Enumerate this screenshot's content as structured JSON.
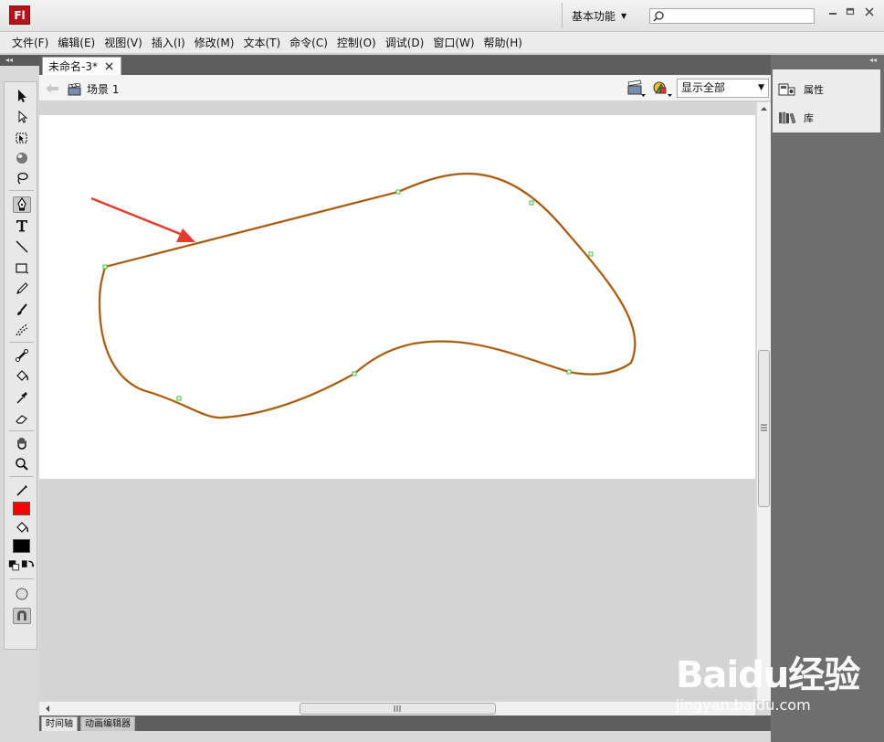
{
  "app": {
    "logo_text": "Fl"
  },
  "titlebar": {
    "workspace_label": "基本功能",
    "search_value": ""
  },
  "menu": {
    "items": [
      "文件(F)",
      "编辑(E)",
      "视图(V)",
      "插入(I)",
      "修改(M)",
      "文本(T)",
      "命令(C)",
      "控制(O)",
      "调试(D)",
      "窗口(W)",
      "帮助(H)"
    ]
  },
  "document": {
    "tab_label": "未命名-3*",
    "scene_label": "场景 1",
    "zoom_value": "显示全部"
  },
  "right_panel": {
    "items": [
      {
        "label": "属性",
        "icon": "properties-icon"
      },
      {
        "label": "库",
        "icon": "library-icon"
      }
    ]
  },
  "bottom_tabs": [
    "时间轴",
    "动画编辑器"
  ],
  "colors": {
    "stroke": "#FF0000",
    "fill": "#000000",
    "shape_stroke": "#c0751f",
    "arrow": "#e63a2e"
  },
  "watermark": {
    "line1": "Baidu经验",
    "line2": "jingyan.baidu.com"
  }
}
